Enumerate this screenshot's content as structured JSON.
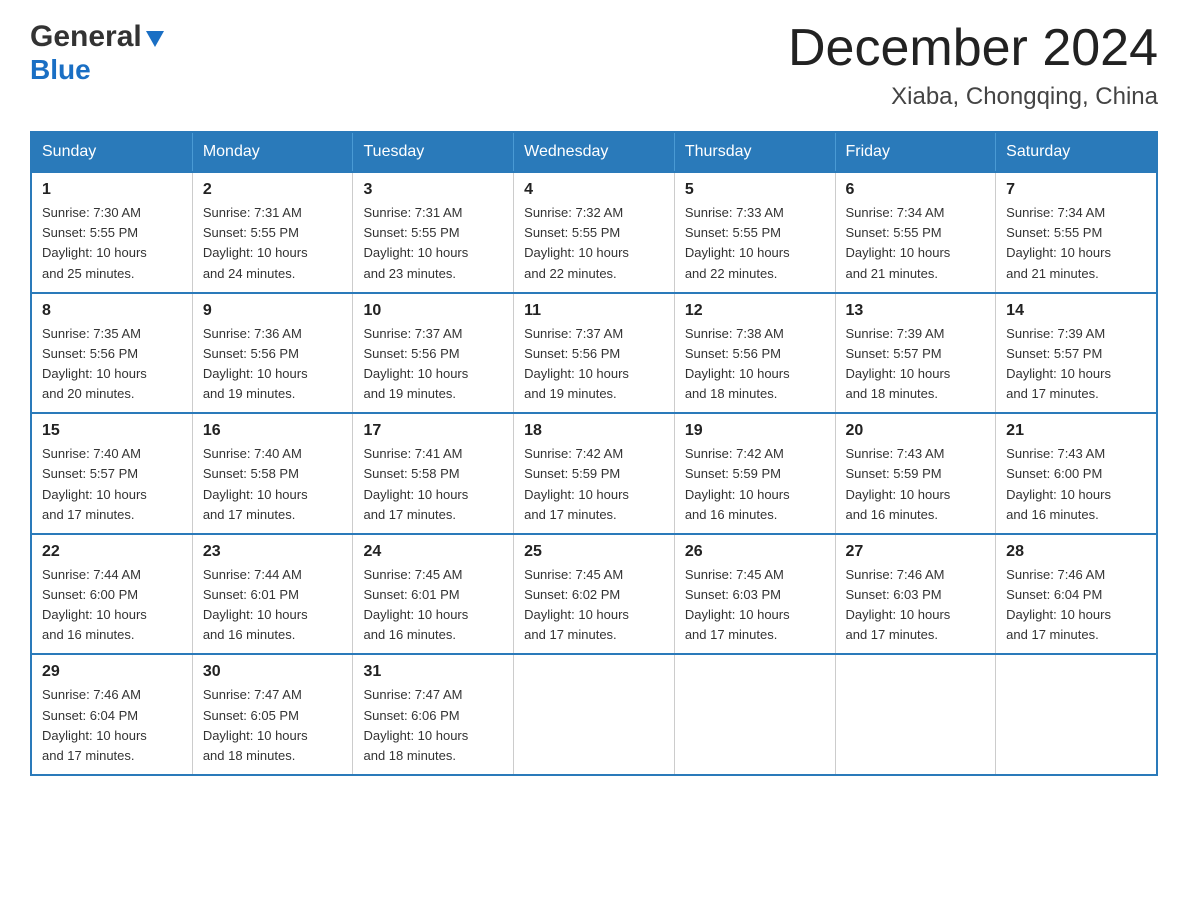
{
  "logo": {
    "general": "General",
    "blue": "Blue"
  },
  "title": "December 2024",
  "subtitle": "Xiaba, Chongqing, China",
  "weekdays": [
    "Sunday",
    "Monday",
    "Tuesday",
    "Wednesday",
    "Thursday",
    "Friday",
    "Saturday"
  ],
  "weeks": [
    [
      {
        "day": "1",
        "info": "Sunrise: 7:30 AM\nSunset: 5:55 PM\nDaylight: 10 hours\nand 25 minutes."
      },
      {
        "day": "2",
        "info": "Sunrise: 7:31 AM\nSunset: 5:55 PM\nDaylight: 10 hours\nand 24 minutes."
      },
      {
        "day": "3",
        "info": "Sunrise: 7:31 AM\nSunset: 5:55 PM\nDaylight: 10 hours\nand 23 minutes."
      },
      {
        "day": "4",
        "info": "Sunrise: 7:32 AM\nSunset: 5:55 PM\nDaylight: 10 hours\nand 22 minutes."
      },
      {
        "day": "5",
        "info": "Sunrise: 7:33 AM\nSunset: 5:55 PM\nDaylight: 10 hours\nand 22 minutes."
      },
      {
        "day": "6",
        "info": "Sunrise: 7:34 AM\nSunset: 5:55 PM\nDaylight: 10 hours\nand 21 minutes."
      },
      {
        "day": "7",
        "info": "Sunrise: 7:34 AM\nSunset: 5:55 PM\nDaylight: 10 hours\nand 21 minutes."
      }
    ],
    [
      {
        "day": "8",
        "info": "Sunrise: 7:35 AM\nSunset: 5:56 PM\nDaylight: 10 hours\nand 20 minutes."
      },
      {
        "day": "9",
        "info": "Sunrise: 7:36 AM\nSunset: 5:56 PM\nDaylight: 10 hours\nand 19 minutes."
      },
      {
        "day": "10",
        "info": "Sunrise: 7:37 AM\nSunset: 5:56 PM\nDaylight: 10 hours\nand 19 minutes."
      },
      {
        "day": "11",
        "info": "Sunrise: 7:37 AM\nSunset: 5:56 PM\nDaylight: 10 hours\nand 19 minutes."
      },
      {
        "day": "12",
        "info": "Sunrise: 7:38 AM\nSunset: 5:56 PM\nDaylight: 10 hours\nand 18 minutes."
      },
      {
        "day": "13",
        "info": "Sunrise: 7:39 AM\nSunset: 5:57 PM\nDaylight: 10 hours\nand 18 minutes."
      },
      {
        "day": "14",
        "info": "Sunrise: 7:39 AM\nSunset: 5:57 PM\nDaylight: 10 hours\nand 17 minutes."
      }
    ],
    [
      {
        "day": "15",
        "info": "Sunrise: 7:40 AM\nSunset: 5:57 PM\nDaylight: 10 hours\nand 17 minutes."
      },
      {
        "day": "16",
        "info": "Sunrise: 7:40 AM\nSunset: 5:58 PM\nDaylight: 10 hours\nand 17 minutes."
      },
      {
        "day": "17",
        "info": "Sunrise: 7:41 AM\nSunset: 5:58 PM\nDaylight: 10 hours\nand 17 minutes."
      },
      {
        "day": "18",
        "info": "Sunrise: 7:42 AM\nSunset: 5:59 PM\nDaylight: 10 hours\nand 17 minutes."
      },
      {
        "day": "19",
        "info": "Sunrise: 7:42 AM\nSunset: 5:59 PM\nDaylight: 10 hours\nand 16 minutes."
      },
      {
        "day": "20",
        "info": "Sunrise: 7:43 AM\nSunset: 5:59 PM\nDaylight: 10 hours\nand 16 minutes."
      },
      {
        "day": "21",
        "info": "Sunrise: 7:43 AM\nSunset: 6:00 PM\nDaylight: 10 hours\nand 16 minutes."
      }
    ],
    [
      {
        "day": "22",
        "info": "Sunrise: 7:44 AM\nSunset: 6:00 PM\nDaylight: 10 hours\nand 16 minutes."
      },
      {
        "day": "23",
        "info": "Sunrise: 7:44 AM\nSunset: 6:01 PM\nDaylight: 10 hours\nand 16 minutes."
      },
      {
        "day": "24",
        "info": "Sunrise: 7:45 AM\nSunset: 6:01 PM\nDaylight: 10 hours\nand 16 minutes."
      },
      {
        "day": "25",
        "info": "Sunrise: 7:45 AM\nSunset: 6:02 PM\nDaylight: 10 hours\nand 17 minutes."
      },
      {
        "day": "26",
        "info": "Sunrise: 7:45 AM\nSunset: 6:03 PM\nDaylight: 10 hours\nand 17 minutes."
      },
      {
        "day": "27",
        "info": "Sunrise: 7:46 AM\nSunset: 6:03 PM\nDaylight: 10 hours\nand 17 minutes."
      },
      {
        "day": "28",
        "info": "Sunrise: 7:46 AM\nSunset: 6:04 PM\nDaylight: 10 hours\nand 17 minutes."
      }
    ],
    [
      {
        "day": "29",
        "info": "Sunrise: 7:46 AM\nSunset: 6:04 PM\nDaylight: 10 hours\nand 17 minutes."
      },
      {
        "day": "30",
        "info": "Sunrise: 7:47 AM\nSunset: 6:05 PM\nDaylight: 10 hours\nand 18 minutes."
      },
      {
        "day": "31",
        "info": "Sunrise: 7:47 AM\nSunset: 6:06 PM\nDaylight: 10 hours\nand 18 minutes."
      },
      {
        "day": "",
        "info": ""
      },
      {
        "day": "",
        "info": ""
      },
      {
        "day": "",
        "info": ""
      },
      {
        "day": "",
        "info": ""
      }
    ]
  ]
}
